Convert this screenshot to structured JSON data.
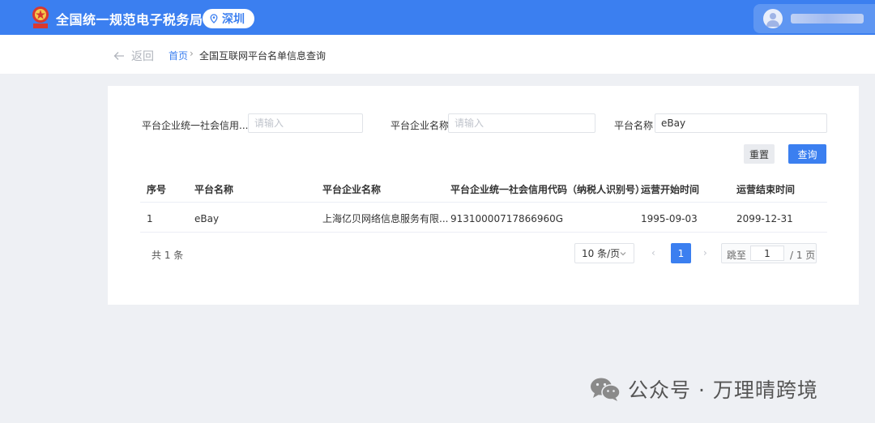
{
  "header": {
    "app_title": "全国统一规范电子税务局",
    "city": "深圳"
  },
  "breadcrumb": {
    "back_label": "返回",
    "home": "首页",
    "separator": "›",
    "current": "全国互联网平台名单信息查询"
  },
  "filters": {
    "credit_code_label": "平台企业统一社会信用...",
    "credit_code_placeholder": "请输入",
    "company_name_label": "平台企业名称",
    "company_name_placeholder": "请输入",
    "platform_name_label": "平台名称",
    "platform_name_value": "eBay",
    "reset_label": "重置",
    "query_label": "查询"
  },
  "table": {
    "headers": [
      "序号",
      "平台名称",
      "平台企业名称",
      "平台企业统一社会信用代码（纳税人识别号）",
      "运营开始时间",
      "运营结束时间"
    ],
    "rows": [
      [
        "1",
        "eBay",
        "上海亿贝网络信息服务有限...",
        "91310000717866960G",
        "1995-09-03",
        "2099-12-31"
      ]
    ]
  },
  "pagination": {
    "total": "共 1 条",
    "page_size": "10 条/页",
    "prev": "‹",
    "current_page": "1",
    "next": "›",
    "jump_label": "跳至",
    "jump_value": "1",
    "total_pages": "/ 1 页"
  },
  "watermark": {
    "text": "公众号 · 万理晴跨境"
  },
  "colors": {
    "primary": "#3b7ff0",
    "header_bg": "#3b7ff0",
    "page_bg": "#eef0f4"
  }
}
